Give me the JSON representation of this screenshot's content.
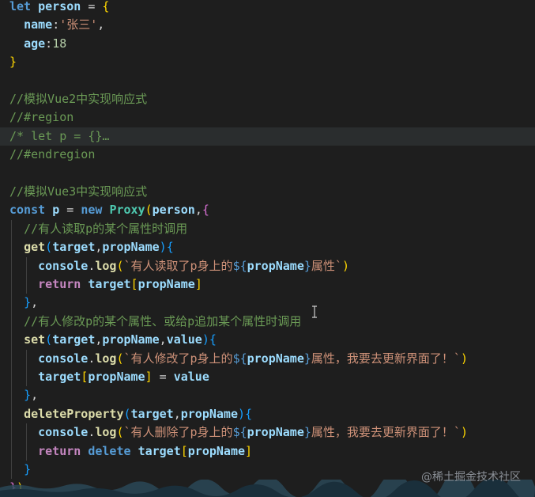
{
  "editor": {
    "lines": [
      [
        "let",
        " ",
        "person",
        " = ",
        "{"
      ],
      [
        "  ",
        "name",
        ":",
        "'张三'",
        ","
      ],
      [
        "  ",
        "age",
        ":",
        "18"
      ],
      [
        "}"
      ],
      [
        ""
      ],
      [
        "//模拟Vue2中实现响应式"
      ],
      [
        "//#region"
      ],
      [
        "/* let p = {}",
        "…"
      ],
      [
        "//#endregion"
      ],
      [
        ""
      ],
      [
        "//模拟Vue3中实现响应式"
      ],
      [
        "const",
        " ",
        "p",
        " = ",
        "new",
        " ",
        "Proxy",
        "(",
        "person",
        ",",
        "{"
      ],
      [
        "  ",
        "//有人读取p的某个属性时调用"
      ],
      [
        "  ",
        "get",
        "(",
        "target",
        ",",
        "propName",
        ")",
        "{"
      ],
      [
        "    ",
        "console",
        ".",
        "log",
        "(",
        "`有人读取了p身上的",
        "${",
        "propName",
        "}",
        "属性`",
        ")"
      ],
      [
        "    ",
        "return",
        " ",
        "target",
        "[",
        "propName",
        "]"
      ],
      [
        "  ",
        "}",
        ","
      ],
      [
        "  ",
        "//有人修改p的某个属性、或给p追加某个属性时调用"
      ],
      [
        "  ",
        "set",
        "(",
        "target",
        ",",
        "propName",
        ",",
        "value",
        ")",
        "{"
      ],
      [
        "    ",
        "console",
        ".",
        "log",
        "(",
        "`有人修改了p身上的",
        "${",
        "propName",
        "}",
        "属性，我要去更新界面了！`",
        ")"
      ],
      [
        "    ",
        "target",
        "[",
        "propName",
        "]",
        " = ",
        "value"
      ],
      [
        "  ",
        "}",
        ","
      ],
      [
        "  ",
        "deleteProperty",
        "(",
        "target",
        ",",
        "propName",
        ")",
        "{"
      ],
      [
        "    ",
        "console",
        ".",
        "log",
        "(",
        "`有人删除了p身上的",
        "${",
        "propName",
        "}",
        "属性，我要去更新界面了！`",
        ")"
      ],
      [
        "    ",
        "return",
        " ",
        "delete",
        " ",
        "target",
        "[",
        "propName",
        "]"
      ],
      [
        "  ",
        "}"
      ],
      [
        "}",
        ")"
      ]
    ],
    "classes": [
      [
        "kw",
        "",
        "var",
        "punc",
        "brace"
      ],
      [
        "",
        "var",
        "punc",
        "str",
        "punc"
      ],
      [
        "",
        "var",
        "punc",
        "num"
      ],
      [
        "brace"
      ],
      [
        ""
      ],
      [
        "cm"
      ],
      [
        "cm"
      ],
      [
        "cm",
        "cm"
      ],
      [
        "cm"
      ],
      [
        ""
      ],
      [
        "cm"
      ],
      [
        "kw",
        "",
        "var",
        "punc",
        "kw",
        "",
        "cls",
        "brace",
        "var",
        "punc",
        "brace2"
      ],
      [
        "",
        "cm"
      ],
      [
        "",
        "fn",
        "brace3",
        "var",
        "punc",
        "var",
        "brace3",
        "brace3"
      ],
      [
        "",
        "var",
        "punc",
        "fn",
        "brace",
        "str",
        "tplexp",
        "var",
        "tplexp",
        "str",
        "brace"
      ],
      [
        "",
        "kwc",
        "",
        "var",
        "brace",
        "var",
        "brace"
      ],
      [
        "",
        "brace3",
        "punc"
      ],
      [
        "",
        "cm"
      ],
      [
        "",
        "fn",
        "brace3",
        "var",
        "punc",
        "var",
        "punc",
        "var",
        "brace3",
        "brace3"
      ],
      [
        "",
        "var",
        "punc",
        "fn",
        "brace",
        "str",
        "tplexp",
        "var",
        "tplexp",
        "str",
        "brace"
      ],
      [
        "",
        "var",
        "brace",
        "var",
        "brace",
        "punc",
        "var"
      ],
      [
        "",
        "brace3",
        "punc"
      ],
      [
        "",
        "fn",
        "brace3",
        "var",
        "punc",
        "var",
        "brace3",
        "brace3"
      ],
      [
        "",
        "var",
        "punc",
        "fn",
        "brace",
        "str",
        "tplexp",
        "var",
        "tplexp",
        "str",
        "brace"
      ],
      [
        "",
        "kwc",
        "",
        "kw",
        "",
        "var",
        "brace",
        "var",
        "brace"
      ],
      [
        "",
        "brace3"
      ],
      [
        "brace2",
        "brace"
      ]
    ],
    "highlighted_line": 7
  },
  "watermark": "@稀土掘金技术社区",
  "colors": {
    "background": "#1e1e1e",
    "keyword": "#569cd6",
    "control_keyword": "#c586c0",
    "variable": "#9cdcfe",
    "function": "#dcdcaa",
    "class": "#4ec9b0",
    "string": "#ce9178",
    "number": "#b5cea8",
    "comment": "#6a9955"
  }
}
